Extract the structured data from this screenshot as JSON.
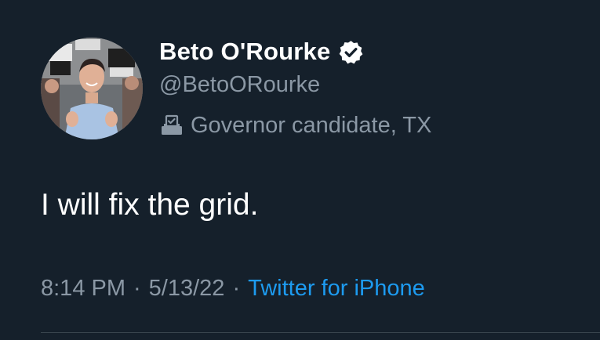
{
  "author": {
    "display_name": "Beto O'Rourke",
    "handle": "@BetoORourke",
    "verified": true,
    "label": "Governor candidate, TX",
    "label_icon": "ballot-box-icon",
    "avatar": "profile-photo"
  },
  "tweet": {
    "text": "I will fix the grid."
  },
  "meta": {
    "time": "8:14 PM",
    "separator": "·",
    "date": "5/13/22",
    "source": "Twitter for iPhone"
  },
  "colors": {
    "background": "#15202b",
    "primary_text": "#ffffff",
    "secondary_text": "#8b98a5",
    "link": "#1d9bf0",
    "divider": "#38444d"
  }
}
